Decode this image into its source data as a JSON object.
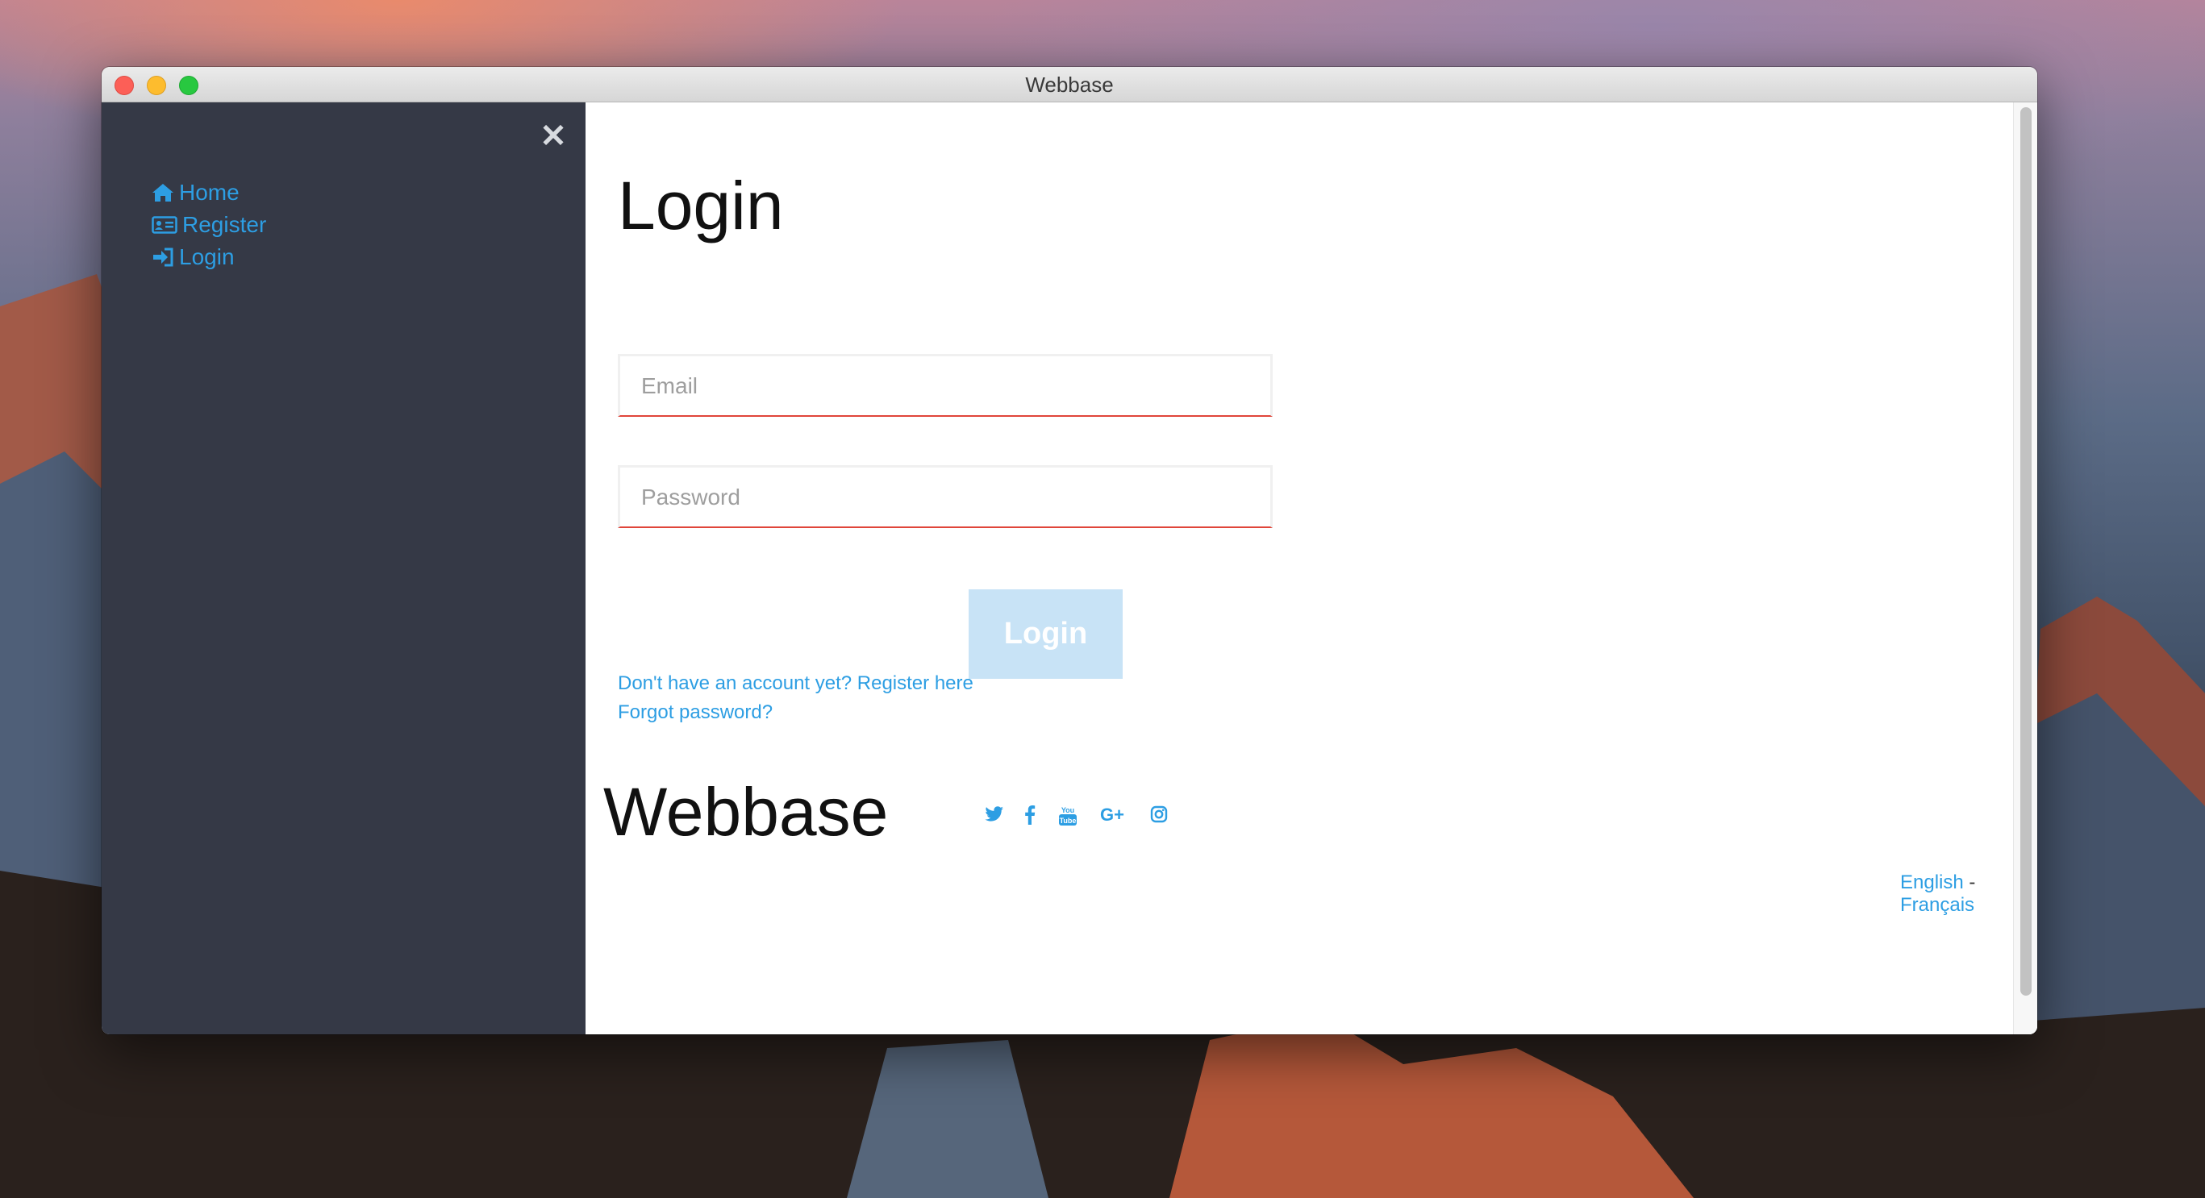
{
  "window": {
    "title": "Webbase"
  },
  "sidebar": {
    "close_icon": "close-icon",
    "items": [
      {
        "label": "Home",
        "icon": "home-icon"
      },
      {
        "label": "Register",
        "icon": "id-card-icon"
      },
      {
        "label": "Login",
        "icon": "sign-in-icon"
      }
    ]
  },
  "main": {
    "title": "Login",
    "email": {
      "placeholder": "Email",
      "value": ""
    },
    "password": {
      "placeholder": "Password",
      "value": ""
    },
    "submit_label": "Login",
    "register_link": "Don't have an account yet? Register here",
    "forgot_link": "Forgot password?"
  },
  "footer": {
    "brand": "Webbase",
    "social_icons": [
      "twitter-icon",
      "facebook-icon",
      "youtube-icon",
      "google-plus-icon",
      "instagram-icon"
    ],
    "languages": [
      "English",
      "Français"
    ],
    "separator": "-"
  },
  "colors": {
    "sidebar_bg": "#353946",
    "link": "#2d9ee3",
    "field_underline": "#e0453a",
    "button_bg": "#c8e3f6"
  }
}
